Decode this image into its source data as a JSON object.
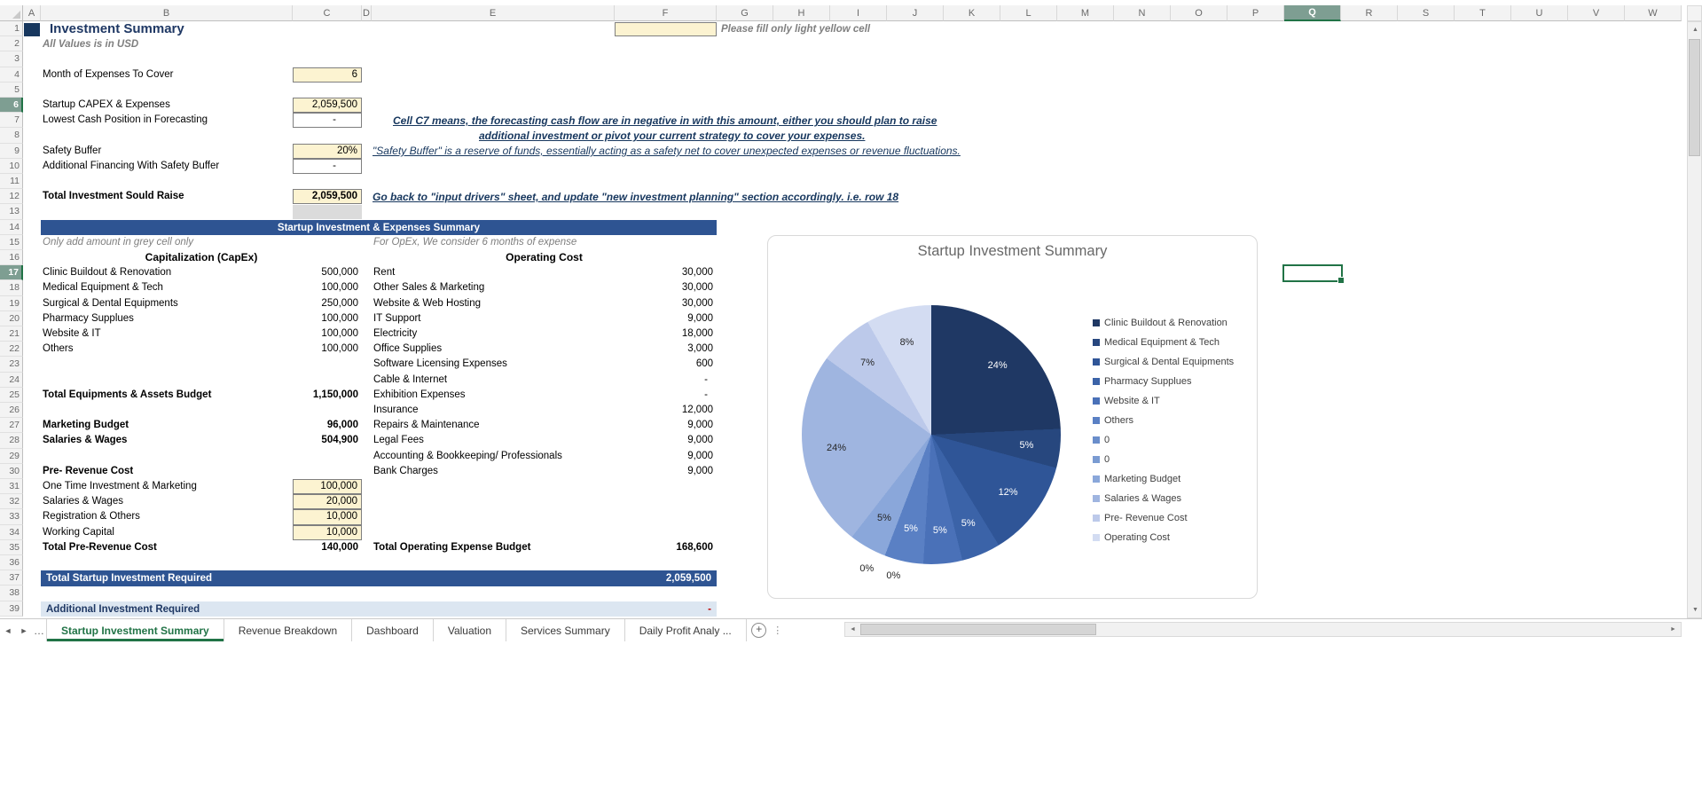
{
  "sheet": {
    "columns": [
      "A",
      "B",
      "C",
      "D",
      "E",
      "F",
      "G",
      "H",
      "I",
      "J",
      "K",
      "L",
      "M",
      "N",
      "O",
      "P",
      "Q",
      "R",
      "S",
      "T",
      "U",
      "V",
      "W"
    ],
    "row_count": 39,
    "selected_column": "Q",
    "selected_rows": [
      6,
      17
    ],
    "selected_cell": "Q17"
  },
  "title_block": {
    "title": "Investment Summary",
    "subtitle": "All Values is in USD"
  },
  "instruction": "Please fill only light yellow cell",
  "drivers": [
    {
      "row": 4,
      "label": "Month of Expenses To Cover",
      "value": "6",
      "cell": "yellow"
    },
    {
      "row": 6,
      "label": "Startup CAPEX & Expenses",
      "value": "2,059,500",
      "cell": "yellow"
    },
    {
      "row": 7,
      "label": "Lowest Cash Position in Forecasting",
      "value": "-",
      "cell": "plain"
    },
    {
      "row": 9,
      "label": "Safety Buffer",
      "value": "20%",
      "cell": "yellow"
    },
    {
      "row": 10,
      "label": "Additional Financing With Safety Buffer",
      "value": "-",
      "cell": "plain"
    },
    {
      "row": 12,
      "label": "Total Investment Sould Raise",
      "value": "2,059,500",
      "cell": "yellow",
      "bold": true
    }
  ],
  "notes": {
    "c7_line1": "Cell C7 means, the forecasting cash flow are in negative in with this amount, either you should plan to raise",
    "c7_line2": "additional investment or pivot your current strategy to cover your expenses.",
    "safety": "\"Safety Buffer\" is a reserve of funds, essentially acting as a safety net to cover unexpected expenses or revenue fluctuations.",
    "raise": "Go back to \"input drivers\" sheet, and update \"new investment planning\" section accordingly. i.e. row 18"
  },
  "summary": {
    "header": "Startup Investment & Expenses Summary",
    "left_hint": "Only add amount in grey cell only",
    "right_hint": "For OpEx, We consider 6 months of expense",
    "capex_title": "Capitalization (CapEx)",
    "opex_title": "Operating Cost",
    "capex_rows": [
      {
        "row": 17,
        "label": "Clinic Buildout & Renovation",
        "value": "500,000"
      },
      {
        "row": 18,
        "label": "Medical Equipment & Tech",
        "value": "100,000"
      },
      {
        "row": 19,
        "label": "Surgical & Dental Equipments",
        "value": "250,000"
      },
      {
        "row": 20,
        "label": "Pharmacy Supplues",
        "value": "100,000"
      },
      {
        "row": 21,
        "label": "Website & IT",
        "value": "100,000"
      },
      {
        "row": 22,
        "label": "Others",
        "value": "100,000"
      },
      {
        "row": 25,
        "label": "Total Equipments & Assets Budget",
        "value": "1,150,000",
        "bold": true
      },
      {
        "row": 27,
        "label": "Marketing Budget",
        "value": "96,000",
        "bold": true
      },
      {
        "row": 28,
        "label": "Salaries & Wages",
        "value": "504,900",
        "bold": true
      },
      {
        "row": 30,
        "label": "Pre- Revenue Cost",
        "value": "",
        "bold": true
      },
      {
        "row": 31,
        "label": "One Time Investment & Marketing",
        "value": "100,000",
        "cell": "yellow"
      },
      {
        "row": 32,
        "label": "Salaries & Wages",
        "value": "20,000",
        "cell": "yellow"
      },
      {
        "row": 33,
        "label": "Registration & Others",
        "value": "10,000",
        "cell": "yellow"
      },
      {
        "row": 34,
        "label": "Working Capital",
        "value": "10,000",
        "cell": "yellow"
      },
      {
        "row": 35,
        "label": "Total Pre-Revenue Cost",
        "value": "140,000",
        "bold": true
      }
    ],
    "opex_rows": [
      {
        "row": 17,
        "label": "Rent",
        "value": "30,000"
      },
      {
        "row": 18,
        "label": "Other Sales & Marketing",
        "value": "30,000"
      },
      {
        "row": 19,
        "label": "Website & Web Hosting",
        "value": "30,000"
      },
      {
        "row": 20,
        "label": "IT Support",
        "value": "9,000"
      },
      {
        "row": 21,
        "label": "Electricity",
        "value": "18,000"
      },
      {
        "row": 22,
        "label": "Office Supplies",
        "value": "3,000"
      },
      {
        "row": 23,
        "label": "Software Licensing Expenses",
        "value": "600"
      },
      {
        "row": 24,
        "label": "Cable & Internet",
        "value": "-"
      },
      {
        "row": 25,
        "label": "Exhibition Expenses",
        "value": "-"
      },
      {
        "row": 26,
        "label": "Insurance",
        "value": "12,000"
      },
      {
        "row": 27,
        "label": "Repairs & Maintenance",
        "value": "9,000"
      },
      {
        "row": 28,
        "label": "Legal Fees",
        "value": "9,000"
      },
      {
        "row": 29,
        "label": "Accounting & Bookkeeping/ Professionals",
        "value": "9,000"
      },
      {
        "row": 30,
        "label": "Bank Charges",
        "value": "9,000"
      },
      {
        "row": 35,
        "label": "Total Operating Expense Budget",
        "value": "168,600",
        "bold": true
      }
    ]
  },
  "totals": {
    "total_label": "Total Startup Investment Required",
    "total_value": "2,059,500",
    "additional_label": "Additional Investment Required",
    "additional_value": "-"
  },
  "chart_data": {
    "type": "pie",
    "title": "Startup Investment Summary",
    "legend_position": "right",
    "total": 2059500,
    "slices": [
      {
        "name": "Clinic Buildout & Renovation",
        "value": 500000,
        "pct_label": "24%",
        "color": "#1F3864",
        "label_light": true
      },
      {
        "name": "Medical Equipment & Tech",
        "value": 100000,
        "pct_label": "5%",
        "color": "#27477E",
        "label_light": true
      },
      {
        "name": "Surgical & Dental Equipments",
        "value": 250000,
        "pct_label": "12%",
        "color": "#2F5597",
        "label_light": true
      },
      {
        "name": "Pharmacy Supplues",
        "value": 100000,
        "pct_label": "5%",
        "color": "#3B63A8",
        "label_light": true
      },
      {
        "name": "Website & IT",
        "value": 100000,
        "pct_label": "5%",
        "color": "#4A71B8",
        "label_light": true
      },
      {
        "name": "Others",
        "value": 100000,
        "pct_label": "5%",
        "color": "#5A80C4",
        "label_light": true
      },
      {
        "name": "0",
        "value": 0,
        "pct_label": "0%",
        "color": "#6A8ECB",
        "label_light": false
      },
      {
        "name": "0",
        "value": 0,
        "pct_label": "0%",
        "color": "#7A9BD2",
        "label_light": false
      },
      {
        "name": "Marketing Budget",
        "value": 96000,
        "pct_label": "5%",
        "color": "#8AA7DA",
        "label_light": false
      },
      {
        "name": "Salaries & Wages",
        "value": 504900,
        "pct_label": "24%",
        "color": "#9FB5E0",
        "label_light": false
      },
      {
        "name": "Pre- Revenue Cost",
        "value": 140000,
        "pct_label": "7%",
        "color": "#BCC9EA",
        "label_light": false
      },
      {
        "name": "Operating Cost",
        "value": 168600,
        "pct_label": "8%",
        "color": "#D3DCF2",
        "label_light": false
      }
    ]
  },
  "tabs": {
    "items": [
      {
        "label": "Startup Investment Summary",
        "active": true
      },
      {
        "label": "Revenue Breakdown"
      },
      {
        "label": "Dashboard"
      },
      {
        "label": "Valuation"
      },
      {
        "label": "Services Summary"
      },
      {
        "label": "Daily Profit Analy ..."
      }
    ]
  }
}
